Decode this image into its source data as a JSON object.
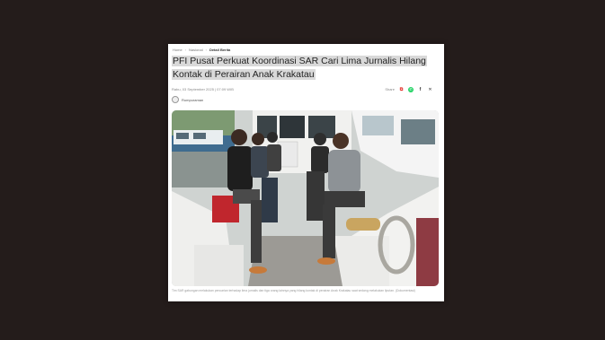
{
  "breadcrumb": {
    "items": [
      "Home",
      "Nasional",
      "Detail Berita"
    ]
  },
  "article": {
    "title": "PFI Pusat Perkuat Koordinasi SAR Cari Lima Jurnalis Hilang Kontak di Perairan Anak Krakatau",
    "date": "Rabu, 03 September 2025 | 07:09 WIB",
    "share_label": "Share",
    "author": "Rumpuraman",
    "caption": "Tim SAR gabungan melakukan pencarian terhadap lima jurnalis dan tiga orang lainnya yang hilang kontak di perairan Anak Krakatau saat sedang melakukan liputan. (Dokumentasi)"
  },
  "share_icons": [
    "link-icon",
    "whatsapp-icon",
    "facebook-icon",
    "x-icon"
  ],
  "colors": {
    "background": "#241c1b",
    "title_highlight": "#d9d9d9",
    "whatsapp": "#25d366",
    "link": "#e5322d"
  }
}
